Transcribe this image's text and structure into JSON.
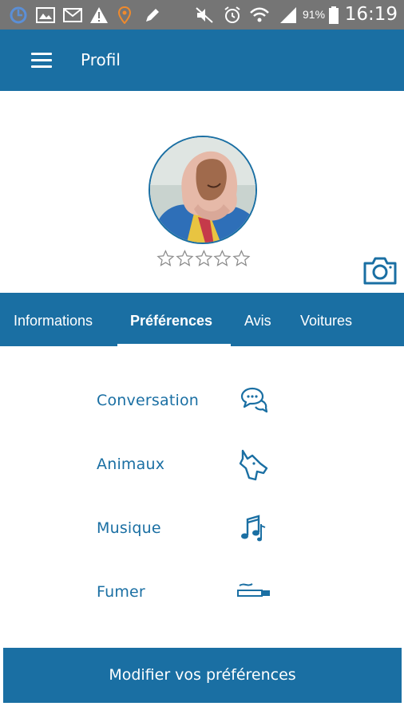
{
  "status_bar": {
    "battery": "91%",
    "time": "16:19"
  },
  "app_bar": {
    "title": "Profil"
  },
  "profile": {
    "rating_stars": 0,
    "rating_max": 5
  },
  "tabs": [
    {
      "label": "Informations",
      "active": false
    },
    {
      "label": "Préférences",
      "active": true
    },
    {
      "label": "Avis",
      "active": false
    },
    {
      "label": "Voitures",
      "active": false
    }
  ],
  "preferences": [
    {
      "label": "Conversation",
      "icon": "conversation-icon"
    },
    {
      "label": "Animaux",
      "icon": "dog-icon"
    },
    {
      "label": "Musique",
      "icon": "music-notes-icon"
    },
    {
      "label": "Fumer",
      "icon": "cigarette-icon"
    }
  ],
  "edit_button": {
    "label": "Modifier vos préférences"
  },
  "colors": {
    "primary": "#1a6fa3",
    "status_bar": "#757575",
    "background": "#ffffff"
  }
}
